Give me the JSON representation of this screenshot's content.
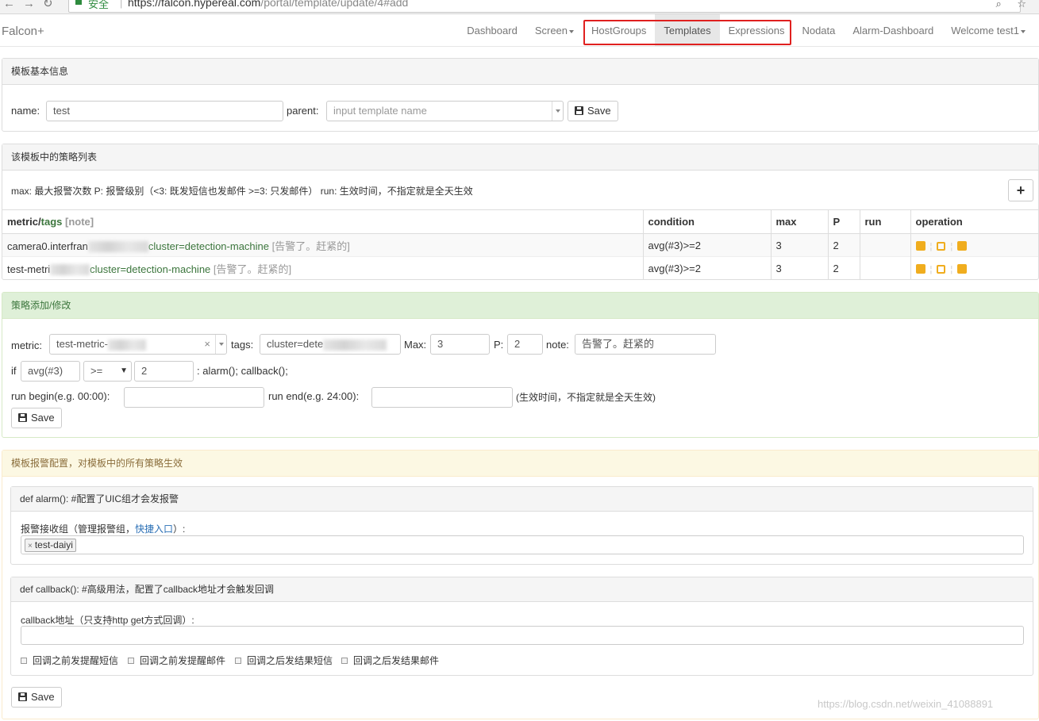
{
  "browser": {
    "secure_label": "安全",
    "url_host": "https://falcon.hypereal.com",
    "url_path": "/portal/template/update/4#add"
  },
  "navbar": {
    "brand": "Falcon+",
    "items": [
      {
        "label": "Dashboard",
        "active": false
      },
      {
        "label": "Screen",
        "active": false,
        "dropdown": true
      },
      {
        "label": "HostGroups",
        "active": false
      },
      {
        "label": "Templates",
        "active": true
      },
      {
        "label": "Expressions",
        "active": false
      },
      {
        "label": "Nodata",
        "active": false
      },
      {
        "label": "Alarm-Dashboard",
        "active": false
      },
      {
        "label": "Welcome test1",
        "active": false,
        "dropdown": true
      }
    ],
    "highlight_color": "#e0201f"
  },
  "basic_info": {
    "heading": "模板基本信息",
    "name_label": "name:",
    "name_value": "test",
    "parent_label": "parent:",
    "parent_placeholder": "input template name",
    "save_label": "Save"
  },
  "strategy_list": {
    "heading": "该模板中的策略列表",
    "legend": "max: 最大报警次数 P: 报警级别（<3: 既发短信也发邮件 >=3: 只发邮件） run: 生效时间，不指定就是全天生效",
    "add_label": "+",
    "columns": {
      "metric": "metric/",
      "tags": "tags",
      "note": "[note]",
      "condition": "condition",
      "max": "max",
      "p": "P",
      "run": "run",
      "operation": "operation"
    },
    "rows": [
      {
        "metric": "camera0.interfran",
        "tags": "cluster=detection-machine",
        "note": "[告警了。赶紧的]",
        "condition": "avg(#3)>=2",
        "max": "3",
        "p": "2",
        "run": ""
      },
      {
        "metric": "test-metri",
        "tags": "cluster=detection-machine",
        "note": "[告警了。赶紧的]",
        "condition": "avg(#3)>=2",
        "max": "3",
        "p": "2",
        "run": ""
      }
    ]
  },
  "strategy_edit": {
    "heading": "策略添加/修改",
    "metric_label": "metric:",
    "metric_value": "test-metric-",
    "metric_clear": "×",
    "tags_label": "tags:",
    "tags_value": "cluster=dete",
    "max_label": "Max:",
    "max_value": "3",
    "p_label": "P:",
    "p_value": "2",
    "note_label": "note:",
    "note_value": "告警了。赶紧的",
    "if_label": "if",
    "func_value": "avg(#3)",
    "operator_value": ">=",
    "threshold_value": "2",
    "action_text": ": alarm(); callback();",
    "run_begin_label": "run begin(e.g. 00:00):",
    "run_end_label": "run end(e.g. 24:00):",
    "run_hint": "(生效时间，不指定就是全天生效)",
    "save_label": "Save"
  },
  "alarm_config": {
    "heading": "模板报警配置，对模板中的所有策略生效",
    "alarm_heading": "def alarm(): #配置了UIC组才会发报警",
    "receiver_label": "报警接收组（管理报警组，",
    "receiver_link": "快捷入口",
    "receiver_label_end": "）:",
    "receiver_chip": "test-daiyi",
    "chip_remove": "×",
    "callback_heading": "def callback(): #高级用法，配置了callback地址才会触发回调",
    "callback_label": "callback地址（只支持http get方式回调）:",
    "callback_value": "",
    "checkboxes": [
      "回调之前发提醒短信",
      "回调之前发提醒邮件",
      "回调之后发结果短信",
      "回调之后发结果邮件"
    ],
    "save_label": "Save"
  },
  "watermark": "https://blog.csdn.net/weixin_41088891"
}
